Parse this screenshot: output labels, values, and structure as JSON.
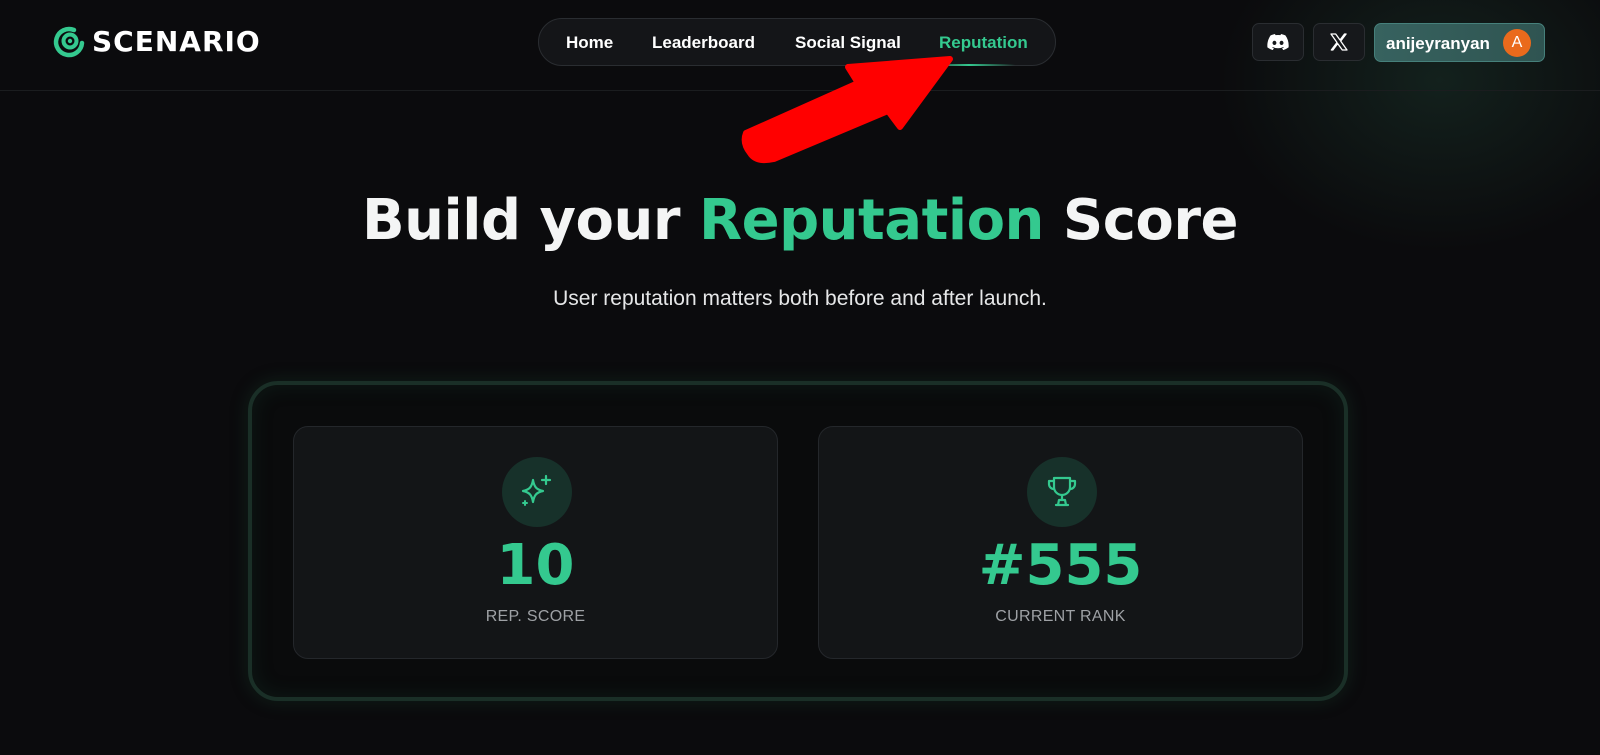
{
  "brand": {
    "name": "SCENARIO",
    "accent_color": "#34c98f"
  },
  "nav": {
    "items": [
      {
        "label": "Home",
        "active": false
      },
      {
        "label": "Leaderboard",
        "active": false
      },
      {
        "label": "Social Signal",
        "active": false
      },
      {
        "label": "Reputation",
        "active": true
      }
    ]
  },
  "header_actions": {
    "discord_icon": "discord-icon",
    "x_icon": "x-logo-icon",
    "username": "anijeyranyan",
    "avatar_initial": "A",
    "avatar_color": "#ea6a1c"
  },
  "hero": {
    "title_prefix": "Build your ",
    "title_accent": "Reputation",
    "title_suffix": " Score",
    "subtitle": "User reputation matters both before and after launch."
  },
  "stats": [
    {
      "icon": "sparkle-icon",
      "value": "10",
      "label": "REP. SCORE"
    },
    {
      "icon": "trophy-icon",
      "value": "#555",
      "label": "CURRENT RANK"
    }
  ],
  "annotation": {
    "arrow_color": "#ff0000"
  }
}
